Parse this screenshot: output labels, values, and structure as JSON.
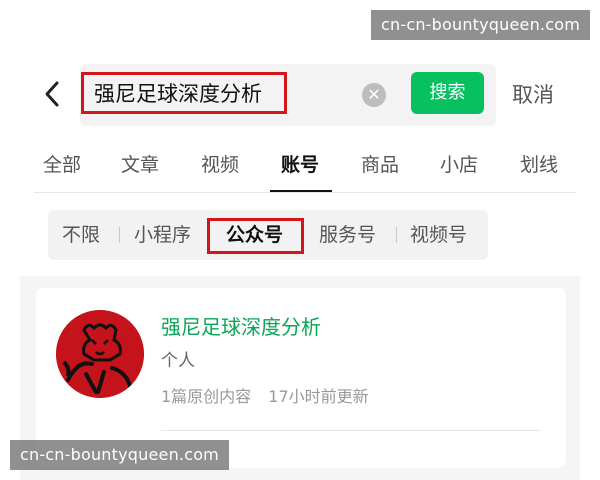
{
  "watermark_top": "cn-cn-bountyqueen.com",
  "watermark_bottom": "cn-cn-bountyqueen.com",
  "header": {
    "back_icon": "chevron-left-icon",
    "search_query": "强尼足球深度分析",
    "clear_icon": "clear-circle-icon",
    "search_button": "搜索",
    "cancel": "取消"
  },
  "tabs": [
    {
      "label": "全部"
    },
    {
      "label": "文章"
    },
    {
      "label": "视频"
    },
    {
      "label": "账号",
      "active": true
    },
    {
      "label": "商品"
    },
    {
      "label": "小店"
    },
    {
      "label": "划线"
    }
  ],
  "filters": [
    {
      "label": "不限"
    },
    {
      "label": "小程序"
    },
    {
      "label": "公众号",
      "active": true
    },
    {
      "label": "服务号"
    },
    {
      "label": "视频号"
    }
  ],
  "result": {
    "name": "强尼足球深度分析",
    "type": "个人",
    "original_count": "1篇原创内容",
    "updated": "17小时前更新"
  },
  "colors": {
    "accent_green": "#07c160",
    "name_green": "#07a657",
    "highlight_red": "#d4161c",
    "avatar_red": "#c4131b"
  }
}
